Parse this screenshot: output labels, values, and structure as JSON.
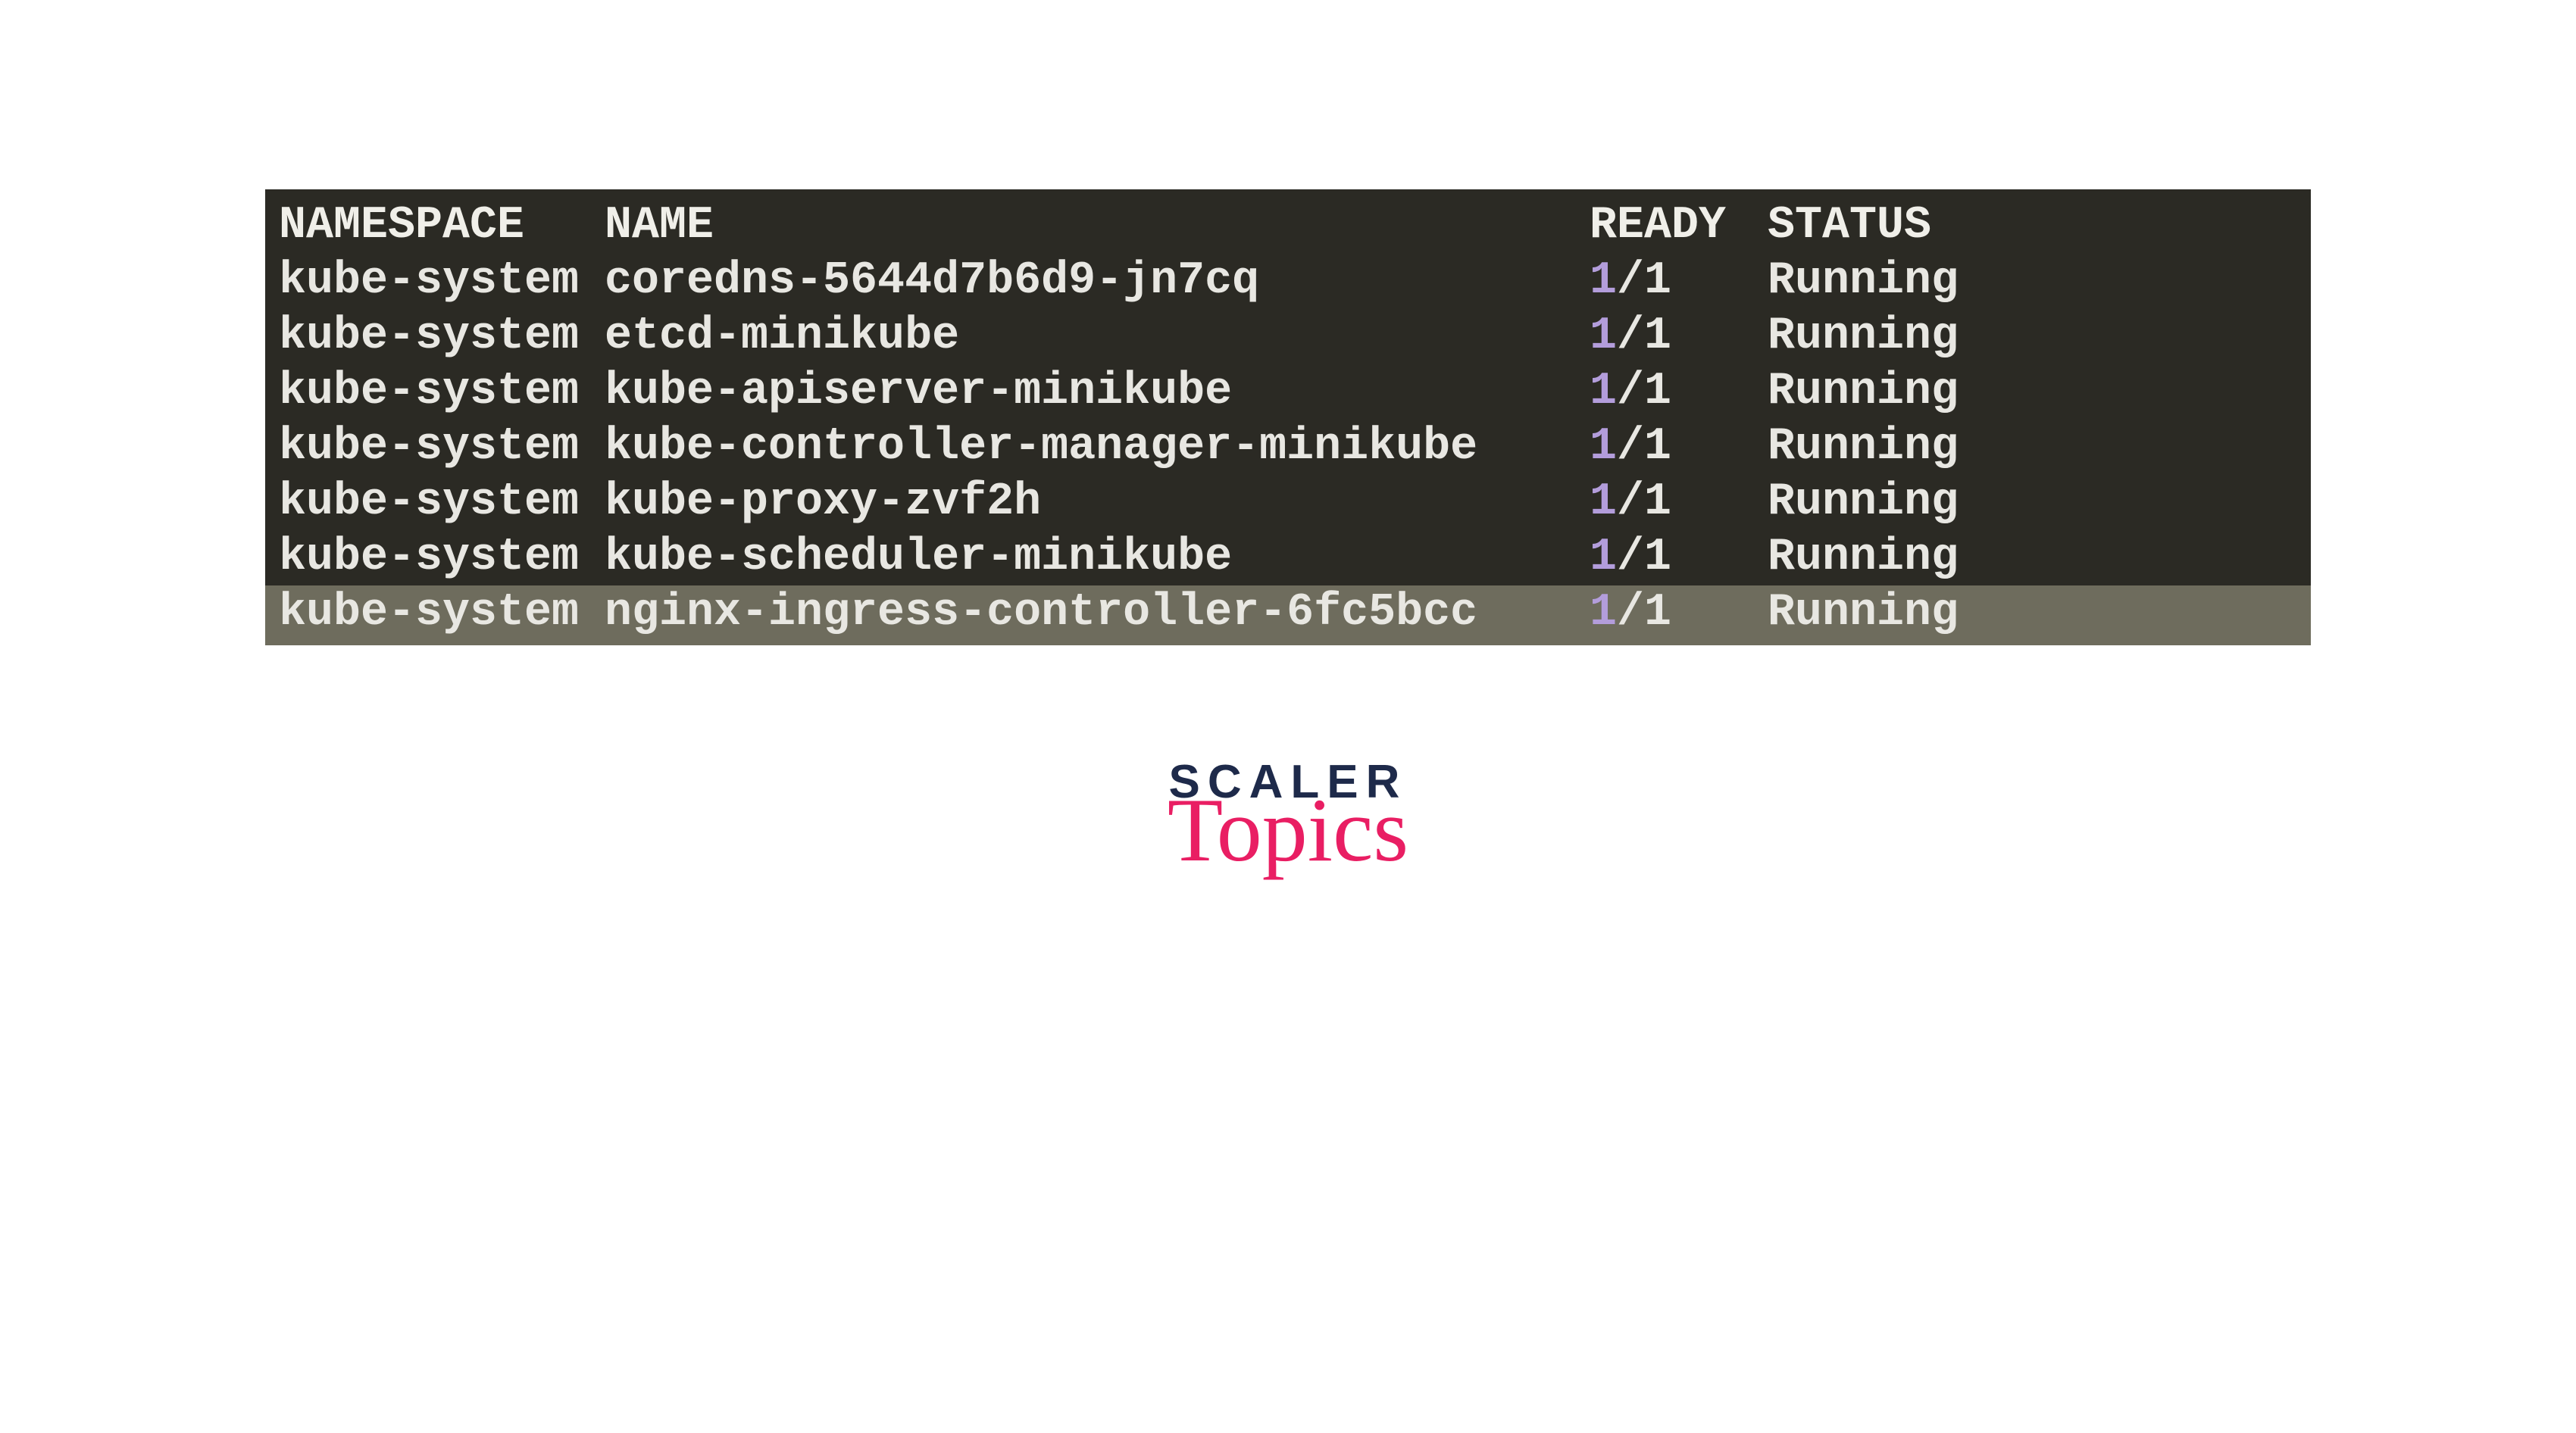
{
  "terminal": {
    "headers": {
      "namespace": "NAMESPACE",
      "name": "NAME",
      "ready": "READY",
      "status": "STATUS"
    },
    "rows": [
      {
        "namespace": "kube-system",
        "name": "coredns-5644d7b6d9-jn7cq",
        "ready_n": "1",
        "ready_t": "1",
        "status": "Running",
        "highlight": false
      },
      {
        "namespace": "kube-system",
        "name": "etcd-minikube",
        "ready_n": "1",
        "ready_t": "1",
        "status": "Running",
        "highlight": false
      },
      {
        "namespace": "kube-system",
        "name": "kube-apiserver-minikube",
        "ready_n": "1",
        "ready_t": "1",
        "status": "Running",
        "highlight": false
      },
      {
        "namespace": "kube-system",
        "name": "kube-controller-manager-minikube",
        "ready_n": "1",
        "ready_t": "1",
        "status": "Running",
        "highlight": false
      },
      {
        "namespace": "kube-system",
        "name": "kube-proxy-zvf2h",
        "ready_n": "1",
        "ready_t": "1",
        "status": "Running",
        "highlight": false
      },
      {
        "namespace": "kube-system",
        "name": "kube-scheduler-minikube",
        "ready_n": "1",
        "ready_t": "1",
        "status": "Running",
        "highlight": false
      },
      {
        "namespace": "kube-system",
        "name": "nginx-ingress-controller-6fc5bcc",
        "ready_n": "1",
        "ready_t": "1",
        "status": "Running",
        "highlight": true
      }
    ]
  },
  "logo": {
    "line1": "SCALER",
    "line2": "Topics"
  },
  "colors": {
    "terminal_bg": "#2b2a24",
    "text": "#e8e7e2",
    "highlight_bg": "#6e6c5d",
    "ready_number": "#b39ddb",
    "logo_dark": "#1e2a4a",
    "logo_pink": "#e91e63"
  }
}
